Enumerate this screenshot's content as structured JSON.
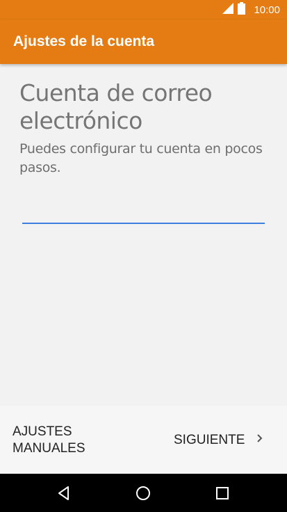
{
  "status_bar": {
    "time": "10:00",
    "icons": [
      "signal-icon",
      "battery-icon"
    ]
  },
  "app_bar": {
    "title": "Ajustes de la cuenta"
  },
  "main": {
    "heading": "Cuenta de correo electrónico",
    "description": "Puedes configurar tu cuenta en pocos pasos.",
    "email_value": ""
  },
  "footer": {
    "manual_label": "AJUSTES MANUALES",
    "next_label": "SIGUIENTE",
    "next_icon": "chevron-right-icon"
  },
  "nav_bar": {
    "icons": [
      "back-icon",
      "home-icon",
      "recents-icon"
    ]
  },
  "colors": {
    "accent": "#e47c13",
    "input_underline": "#3f7fe0",
    "nav_background": "#000000"
  }
}
